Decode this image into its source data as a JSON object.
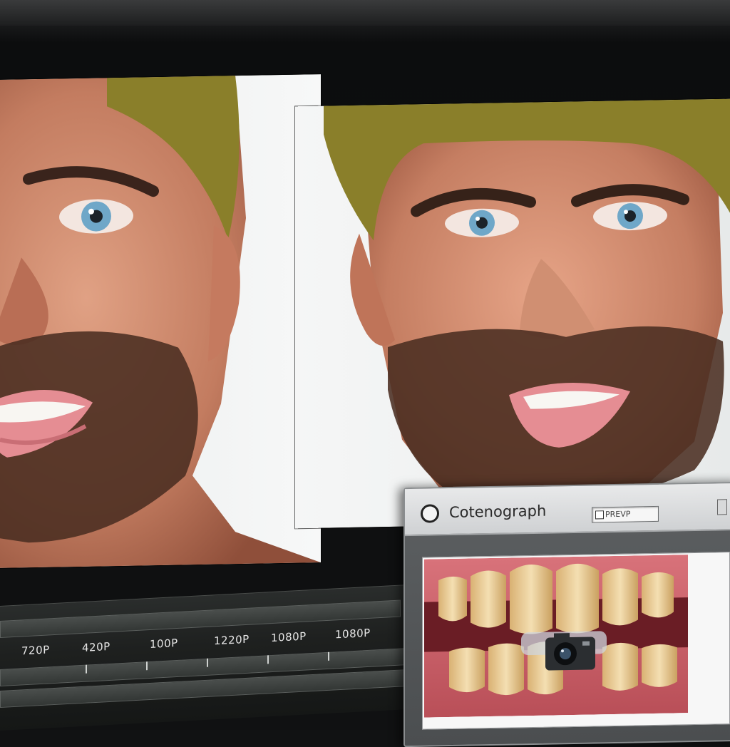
{
  "dialog": {
    "title": "Cotenograph",
    "preview_label": "PREVP",
    "icons": [
      "radio-icon",
      "camera-icon"
    ]
  },
  "timeline": {
    "resolution_labels": [
      "720P",
      "420P",
      "100P",
      "1220P",
      "1080P",
      "1080P"
    ]
  },
  "colors": {
    "background": "#111213",
    "timeline_track": "#3e4240",
    "dialog_frame": "#55585a",
    "dialog_titlebar": "#d9dadb",
    "skin": "#c9846a",
    "hair": "#8a7f2a",
    "iris": "#6fa7c8"
  }
}
